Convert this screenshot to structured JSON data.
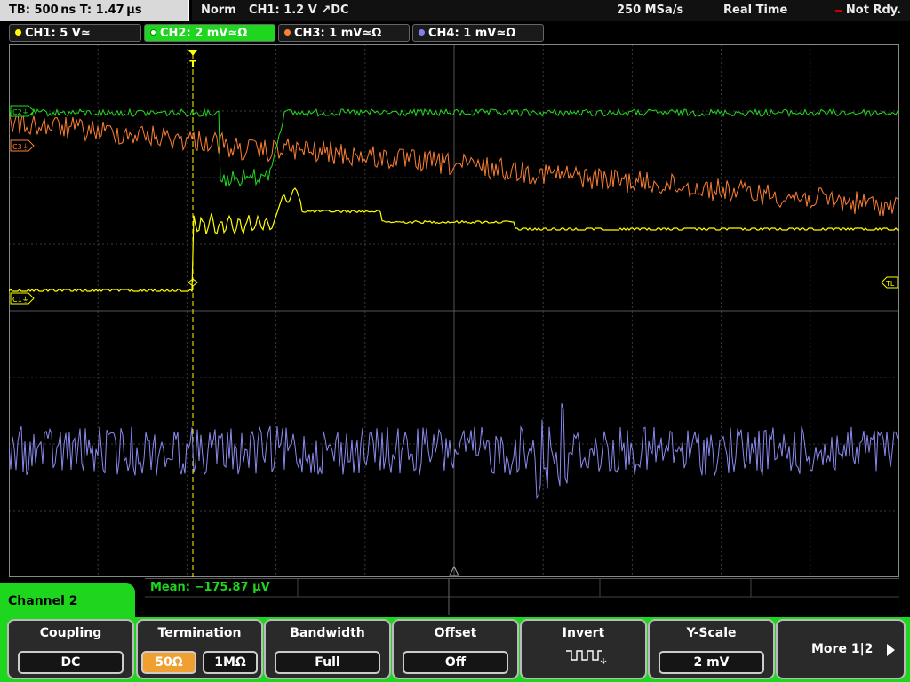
{
  "topbar": {
    "timebase": "TB: 500 ns   T: 1.47 µs",
    "mode": "Norm",
    "trigger": "CH1: 1.2 V ↗DC",
    "sample_rate": "250 MSa/s",
    "acq_mode": "Real Time",
    "status": "Not Rdy."
  },
  "channels": [
    {
      "label": "CH1: 5 V≃",
      "color": "#ffff00"
    },
    {
      "label": "CH2: 2 mV≃Ω",
      "color": "#22dd22"
    },
    {
      "label": "CH3: 1 mV≃Ω",
      "color": "#ff8033"
    },
    {
      "label": "CH4: 1 mV≃Ω",
      "color": "#8080ee"
    }
  ],
  "markers": {
    "c1": "C1⏚",
    "c2": "C2⏚",
    "c3": "C3⏚",
    "tl": "TL",
    "trig": "T"
  },
  "measurement": {
    "mean": "Mean: −175.87 µV"
  },
  "menu": {
    "channel_label": "Channel 2",
    "coupling": {
      "title": "Coupling",
      "value": "DC"
    },
    "termination": {
      "title": "Termination",
      "opt1": "50Ω",
      "opt2": "1MΩ"
    },
    "bandwidth": {
      "title": "Bandwidth",
      "value": "Full"
    },
    "offset": {
      "title": "Offset",
      "value": "Off"
    },
    "invert": {
      "title": "Invert"
    },
    "yscale": {
      "title": "Y-Scale",
      "value": "2 mV"
    },
    "more": "More 1|2"
  }
}
